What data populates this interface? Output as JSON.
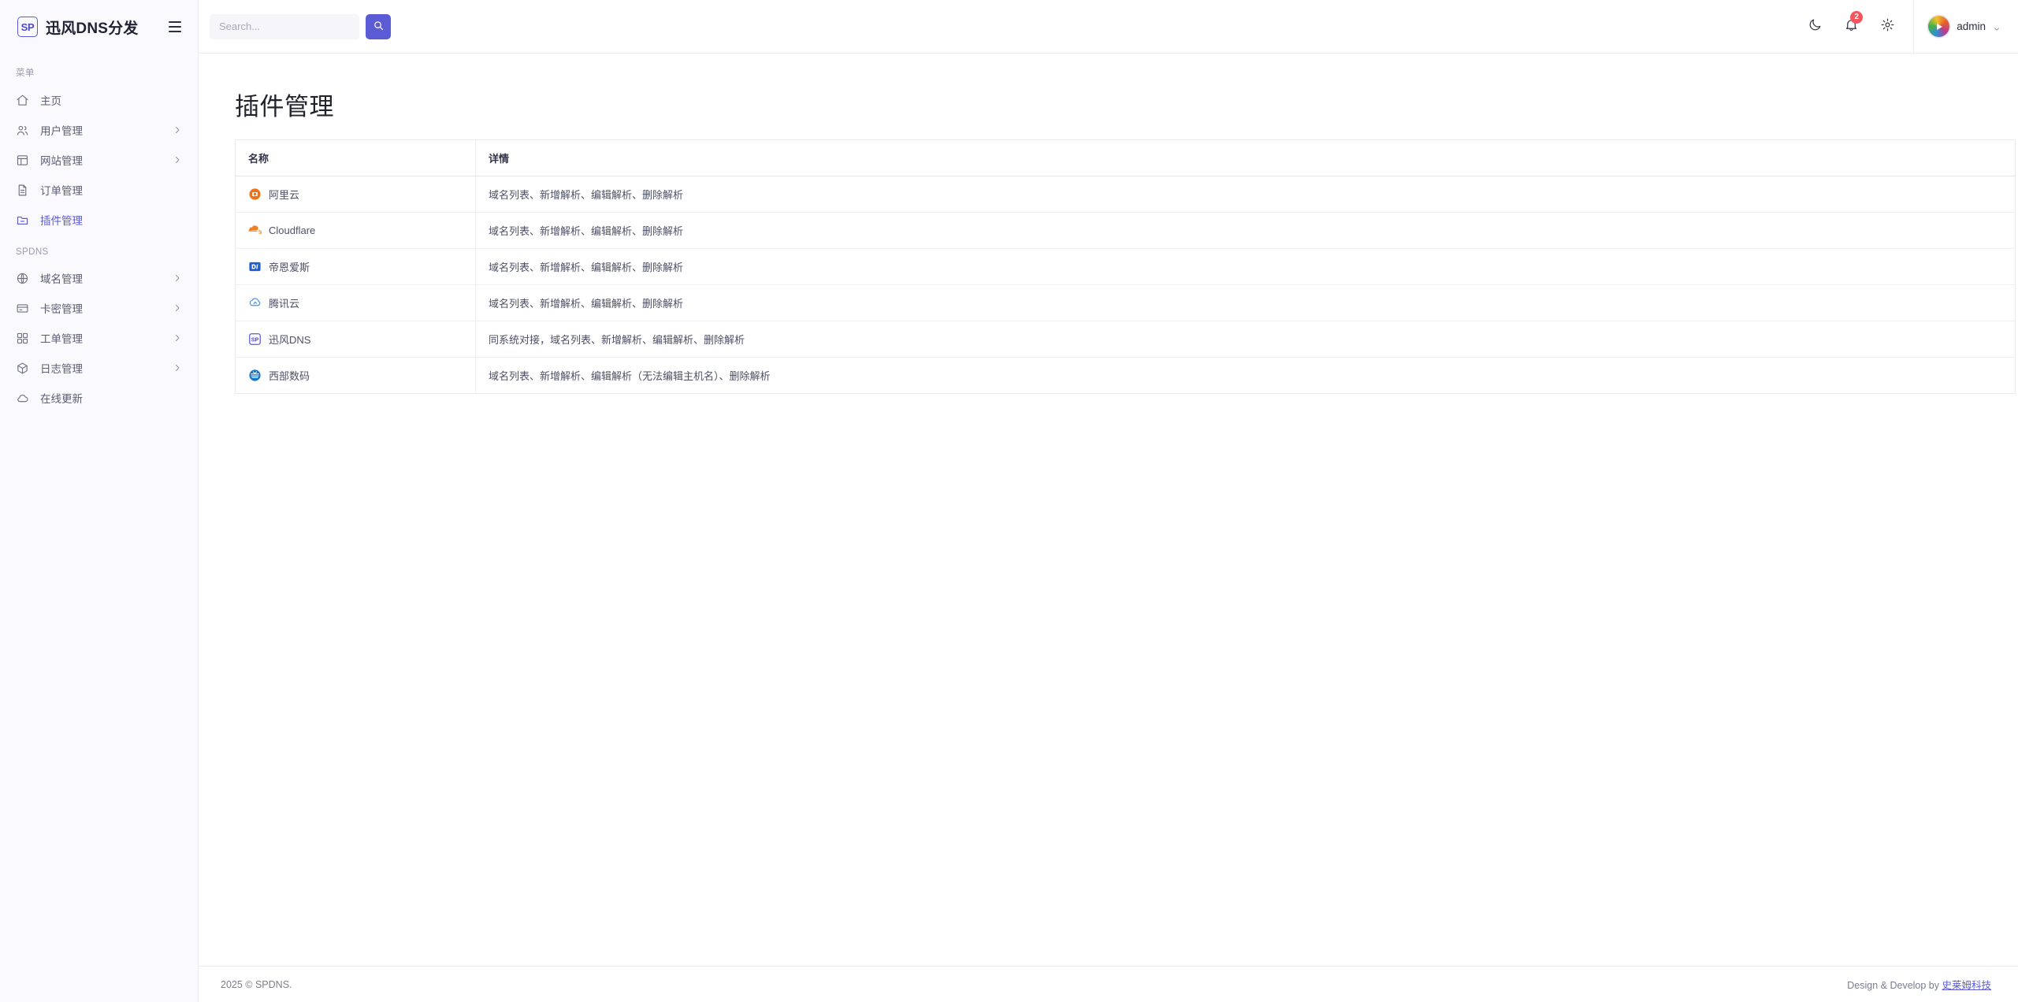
{
  "brand": {
    "badge": "SP",
    "title": "迅风DNS分发",
    "toggle_icon": "hamburger-icon"
  },
  "sidebar": {
    "sections": [
      {
        "title": "菜单",
        "items": [
          {
            "label": "主页",
            "icon": "home-icon",
            "has_chevron": false,
            "active": false
          },
          {
            "label": "用户管理",
            "icon": "users-icon",
            "has_chevron": true,
            "active": false
          },
          {
            "label": "网站管理",
            "icon": "layout-icon",
            "has_chevron": true,
            "active": false
          },
          {
            "label": "订单管理",
            "icon": "file-text-icon",
            "has_chevron": false,
            "active": false
          },
          {
            "label": "插件管理",
            "icon": "folder-icon",
            "has_chevron": false,
            "active": true
          }
        ]
      },
      {
        "title": "SPDNS",
        "items": [
          {
            "label": "域名管理",
            "icon": "globe-box-icon",
            "has_chevron": true,
            "active": false
          },
          {
            "label": "卡密管理",
            "icon": "credit-card-icon",
            "has_chevron": true,
            "active": false
          },
          {
            "label": "工单管理",
            "icon": "grid-icon",
            "has_chevron": true,
            "active": false
          },
          {
            "label": "日志管理",
            "icon": "box-icon",
            "has_chevron": true,
            "active": false
          },
          {
            "label": "在线更新",
            "icon": "cloud-icon",
            "has_chevron": false,
            "active": false
          }
        ]
      }
    ]
  },
  "topbar": {
    "search": {
      "value": "",
      "placeholder": "Search..."
    },
    "search_button_icon": "search-icon",
    "search_button_color": "#5b5bd6",
    "actions": [
      {
        "name": "dark-mode-toggle",
        "icon": "moon-icon"
      },
      {
        "name": "notifications-button",
        "icon": "bell-icon",
        "badge": "2",
        "badge_color": "#f3545d"
      },
      {
        "name": "settings-button",
        "icon": "gear-icon"
      }
    ],
    "user": {
      "name": "admin",
      "avatar": "user-avatar",
      "caret": "chevron-down-icon"
    }
  },
  "main": {
    "page_title": "插件管理",
    "table": {
      "columns": [
        "名称",
        "详情"
      ],
      "rows": [
        {
          "icon": "aliyun-icon",
          "name": "阿里云",
          "detail": "域名列表、新增解析、编辑解析、删除解析"
        },
        {
          "icon": "cloudflare-icon",
          "name": "Cloudflare",
          "detail": "域名列表、新增解析、编辑解析、删除解析"
        },
        {
          "icon": "dnspod-icon",
          "name": "帝恩爱斯",
          "detail": "域名列表、新增解析、编辑解析、删除解析"
        },
        {
          "icon": "tencent-icon",
          "name": "腾讯云",
          "detail": "域名列表、新增解析、编辑解析、删除解析"
        },
        {
          "icon": "spdns-icon",
          "name": "迅风DNS",
          "detail": "同系统对接，域名列表、新增解析、编辑解析、删除解析"
        },
        {
          "icon": "west-icon",
          "name": "西部数码",
          "detail": "域名列表、新增解析、编辑解析（无法编辑主机名）、删除解析"
        }
      ]
    }
  },
  "footer": {
    "left": "2025 © SPDNS.",
    "right_prefix": "Design & Develop by ",
    "right_link": "史莱姆科技"
  }
}
